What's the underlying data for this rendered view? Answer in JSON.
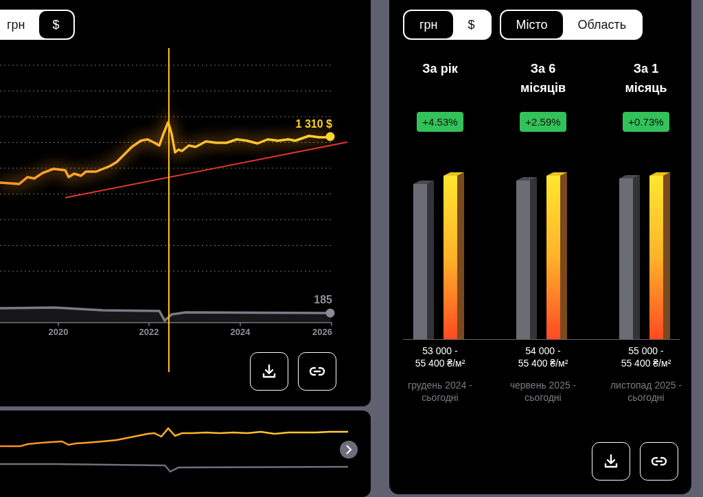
{
  "main_panel": {
    "currency_toggle": [
      {
        "label": "грн",
        "selected": false
      },
      {
        "label": "$",
        "selected": true
      }
    ],
    "chart": {
      "x_labels": [
        "2020",
        "2022",
        "2024",
        "2026"
      ],
      "price_label": "1 310 $",
      "index_label": "185"
    },
    "actions": [
      {
        "kind": "download"
      },
      {
        "kind": "link"
      }
    ]
  },
  "summary_panel": {
    "currency_toggle": [
      {
        "label": "грн",
        "selected": true
      },
      {
        "label": "$",
        "selected": false
      }
    ],
    "region_toggle": [
      {
        "label": "Місто",
        "selected": true
      },
      {
        "label": "Область",
        "selected": false
      }
    ],
    "periods": [
      {
        "title": "За рік",
        "change": "+4.53%",
        "range": "53 000 -\n55 400 ₴/м²",
        "dates": "грудень 2024 -\nсьогодні"
      },
      {
        "title": "За 6\nмісяців",
        "change": "+2.59%",
        "range": "54 000 -\n55 400 ₴/м²",
        "dates": "червень 2025 -\nсьогодні"
      },
      {
        "title": "За 1\nмісяць",
        "change": "+0.73%",
        "range": "55 000 -\n55 400 ₴/м²",
        "dates": "листопад 2025 -\nсьогодні"
      }
    ],
    "actions": [
      {
        "kind": "download"
      },
      {
        "kind": "link"
      }
    ]
  }
}
